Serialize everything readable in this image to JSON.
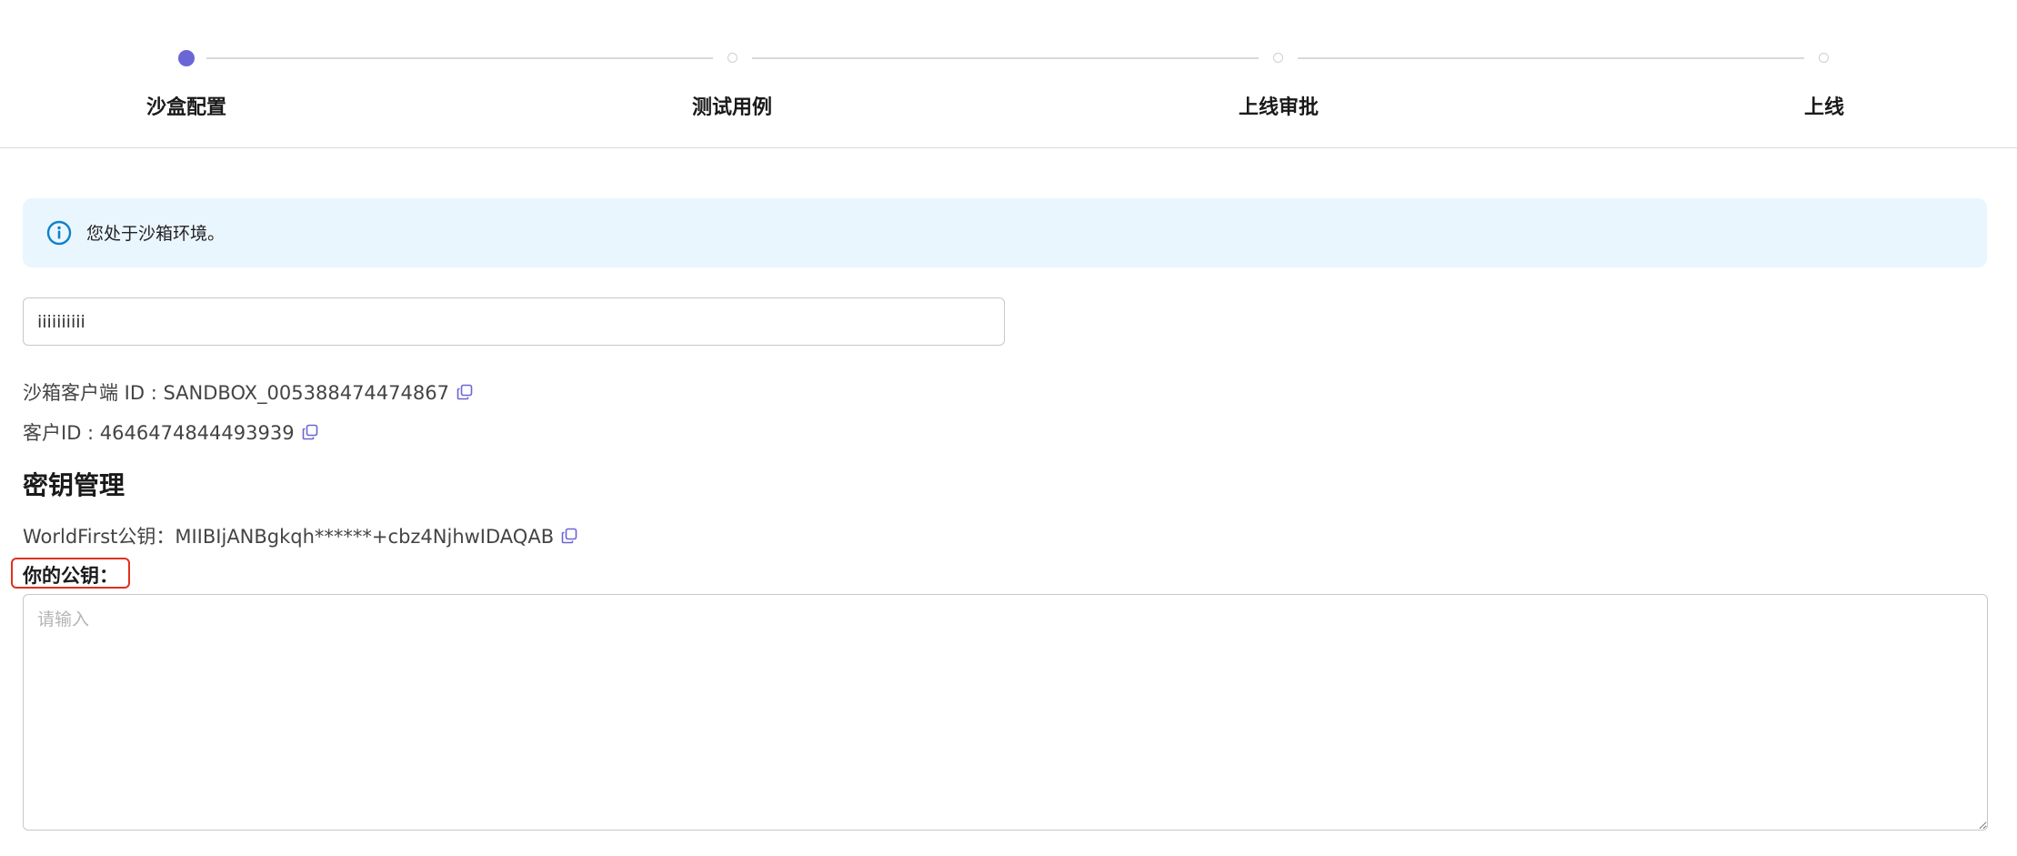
{
  "steps": [
    {
      "label": "沙盒配置",
      "state": "active"
    },
    {
      "label": "测试用例",
      "state": "pending"
    },
    {
      "label": "上线审批",
      "state": "pending"
    },
    {
      "label": "上线",
      "state": "pending"
    }
  ],
  "colors": {
    "accent": "#6b66d6",
    "alert_bg": "#eaf6fd",
    "info_icon": "#0d82c9",
    "highlight_border": "#e0301e"
  },
  "alert": {
    "icon": "info-icon",
    "text": "您处于沙箱环境。"
  },
  "app_name_input": {
    "value": "iiiiiiiiii"
  },
  "sandbox_client_id": {
    "label": "沙箱客户端 ID : SANDBOX_005388474474867",
    "icon": "copy-icon"
  },
  "customer_id": {
    "label": "客户ID : 4646474844493939",
    "icon": "copy-icon"
  },
  "key_management": {
    "title": "密钥管理",
    "worldfirst_key": "WorldFirst公钥：MIIBIjANBgkqh******+cbz4NjhwIDAQAB",
    "your_key_label": "你的公钥：",
    "your_key_placeholder": "请输入"
  }
}
